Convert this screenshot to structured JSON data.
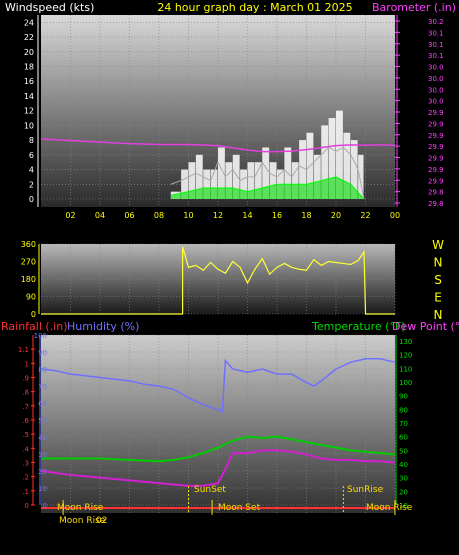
{
  "header": {
    "left_label": "Windspeed (kts)",
    "title": "24 hour graph day : March 01 2025",
    "right_label": "Barometer (.in)"
  },
  "colors": {
    "wind": "#ffffff",
    "gust": "#ffffff",
    "wind_avg": "#00e000",
    "baro": "#e040e0",
    "dir": "#ffff33",
    "humidity": "#7070ff",
    "temperature": "#00cc00",
    "dewpoint": "#d020d0",
    "axis_yellow": "#ffff00",
    "rain": "#ff3030"
  },
  "x_ticks": [
    "02",
    "04",
    "06",
    "08",
    "10",
    "12",
    "14",
    "16",
    "18",
    "20",
    "22",
    "00"
  ],
  "lower_panel_labels": {
    "rainfall": "Rainfall (.in)",
    "humidity": "Humidity (%)",
    "temperature": "Temperature (°F)",
    "dewpoint": "Dew Point (°F)",
    "sunset": "SunSet",
    "sunrise": "SunRise",
    "moonrise_top": "Moon Rise",
    "moonset": "Moon Set",
    "moonrise_top2": "Moon Rise",
    "moonrise_bottom": "Moon Rise",
    "x_first": "02"
  },
  "chart_data": [
    {
      "type": "area",
      "panel": "wind",
      "ylabel": "Windspeed (kts)",
      "ylabel_right": "Barometer (.in)",
      "xlim": [
        0,
        24
      ],
      "ylim": [
        0,
        25
      ],
      "yticks": [
        0,
        2,
        4,
        6,
        8,
        10,
        12,
        14,
        16,
        18,
        20,
        22,
        24
      ],
      "ylim_right": [
        29.79,
        30.25
      ],
      "yticks_right": [
        "29.8",
        "29.8",
        "29.9",
        "29.9",
        "29.9",
        "29.9",
        "29.9",
        "29.9",
        "29.9",
        "30.0",
        "30.0",
        "30.0",
        "30.0",
        "30.1",
        "30.1",
        "30.1",
        "30.2"
      ],
      "series": [
        {
          "name": "Wind speed",
          "x": [
            8.8,
            9.5,
            10.0,
            10.5,
            11.0,
            11.5,
            12.0,
            12.5,
            13.0,
            13.5,
            14.0,
            14.5,
            15.0,
            15.5,
            16.0,
            16.5,
            17.0,
            17.5,
            18.0,
            18.5,
            19.0,
            19.5,
            20.0,
            20.5,
            21.0,
            21.5,
            21.9
          ],
          "values": [
            2,
            2.5,
            3,
            3.5,
            3,
            2.5,
            5,
            3,
            4,
            2.5,
            3,
            3,
            5,
            3.5,
            3,
            4,
            3,
            4.5,
            4,
            5,
            6,
            7,
            6.5,
            7,
            6,
            4,
            0
          ]
        },
        {
          "name": "Wind gust",
          "x": [
            8.8,
            9.5,
            10.0,
            10.5,
            11.0,
            11.5,
            12.0,
            12.5,
            13.0,
            13.5,
            14.0,
            14.5,
            15.0,
            15.5,
            16.0,
            16.5,
            17.0,
            17.5,
            18.0,
            18.5,
            19.0,
            19.5,
            20.0,
            20.5,
            21.0,
            21.5,
            21.9
          ],
          "values": [
            1,
            4,
            5,
            6,
            4,
            4,
            7,
            5,
            6,
            4,
            5,
            5,
            7,
            5,
            4,
            7,
            5,
            8,
            9,
            6,
            10,
            11,
            12,
            9,
            8,
            6,
            0
          ]
        },
        {
          "name": "Wind average",
          "x": [
            8.8,
            10,
            11,
            12,
            13,
            14,
            15,
            16,
            17,
            18,
            19,
            20,
            21,
            21.9
          ],
          "values": [
            0.5,
            1,
            1.5,
            1.5,
            1.5,
            1,
            1.5,
            2,
            2,
            2,
            2.5,
            3,
            2,
            0
          ]
        },
        {
          "name": "Barometer",
          "x": [
            0,
            2,
            4,
            6,
            8,
            10,
            12,
            14,
            15,
            16,
            17,
            18,
            19,
            20,
            21,
            22,
            23,
            24
          ],
          "values": [
            29.952,
            29.948,
            29.944,
            29.94,
            29.938,
            29.938,
            29.935,
            29.924,
            29.92,
            29.92,
            29.921,
            29.925,
            29.93,
            29.935,
            29.937,
            29.936,
            29.937,
            29.936
          ]
        }
      ]
    },
    {
      "type": "line",
      "panel": "direction",
      "xlim": [
        0,
        24
      ],
      "ylim": [
        0,
        360
      ],
      "yticks": [
        0,
        90,
        180,
        270,
        360
      ],
      "compass_labels": [
        "W",
        "N",
        "S",
        "E",
        "N"
      ],
      "series": [
        {
          "name": "Wind direction",
          "x": [
            0,
            9.6,
            9.6,
            10,
            10.5,
            11,
            11.5,
            12,
            12.5,
            13,
            13.5,
            14,
            14.5,
            15,
            15.5,
            16,
            16.5,
            17,
            17.5,
            18,
            18.5,
            19,
            19.5,
            20,
            20.5,
            21,
            21.5,
            21.9,
            22,
            22,
            24
          ],
          "values": [
            0,
            0,
            345,
            240,
            250,
            225,
            265,
            230,
            210,
            270,
            240,
            160,
            230,
            285,
            205,
            240,
            260,
            240,
            230,
            225,
            280,
            250,
            270,
            265,
            260,
            255,
            275,
            320,
            5,
            0,
            0
          ]
        }
      ]
    },
    {
      "type": "line",
      "panel": "climate",
      "xlim": [
        0,
        24
      ],
      "ylabel_left_outer": "Rainfall (.in)",
      "ylabel_left": "Humidity (%)",
      "ylabel_right": "Temperature (°F)",
      "ylabel_right2": "Dew Point (°F)",
      "ylim_rain": [
        0,
        1.2
      ],
      "ylim_humidity": [
        0,
        100
      ],
      "ylim_temp": [
        10,
        130
      ],
      "yticks_humidity": [
        0,
        10,
        20,
        30,
        40,
        50,
        60,
        70,
        80,
        90,
        100
      ],
      "yticks_temp": [
        10,
        20,
        30,
        40,
        50,
        60,
        70,
        80,
        90,
        100,
        110,
        120,
        130
      ],
      "rain_ticks": [
        "0",
        ".1",
        ".2",
        ".3",
        ".4",
        ".5",
        ".6",
        ".7",
        ".8",
        ".9",
        "1",
        "1.1"
      ],
      "series": [
        {
          "name": "Humidity",
          "x": [
            0,
            1,
            2,
            3,
            4,
            5,
            6,
            7,
            8,
            9,
            10,
            11,
            12,
            12.3,
            12.5,
            13,
            14,
            15,
            16,
            17,
            18,
            18.5,
            19,
            20,
            21,
            22,
            23,
            24
          ],
          "values": [
            80,
            79,
            77,
            76,
            75,
            74,
            73,
            71,
            70,
            68,
            63,
            59,
            56,
            55,
            85,
            80,
            78,
            80,
            77,
            77,
            72,
            70,
            73,
            80,
            84,
            86,
            86,
            84
          ]
        },
        {
          "name": "Temperature",
          "x": [
            0,
            2,
            4,
            6,
            8,
            9,
            10,
            11,
            12,
            13,
            14,
            15,
            16,
            17,
            18,
            19,
            20,
            21,
            22,
            23,
            24
          ],
          "values": [
            44,
            44,
            44,
            43,
            42,
            43,
            45,
            48,
            52,
            57,
            60,
            59,
            60,
            58,
            56,
            54,
            52,
            50,
            49,
            48,
            47
          ]
        },
        {
          "name": "Dew Point",
          "x": [
            0,
            2,
            4,
            6,
            8,
            9,
            10,
            11,
            12,
            12.5,
            13,
            14,
            15,
            16,
            17,
            18,
            19,
            20,
            21,
            22,
            23,
            24
          ],
          "values": [
            35,
            32,
            30,
            28,
            26,
            25,
            24,
            24,
            26,
            36,
            48,
            48,
            50,
            50,
            49,
            47,
            44,
            43,
            43,
            42,
            42,
            41
          ]
        }
      ]
    }
  ]
}
